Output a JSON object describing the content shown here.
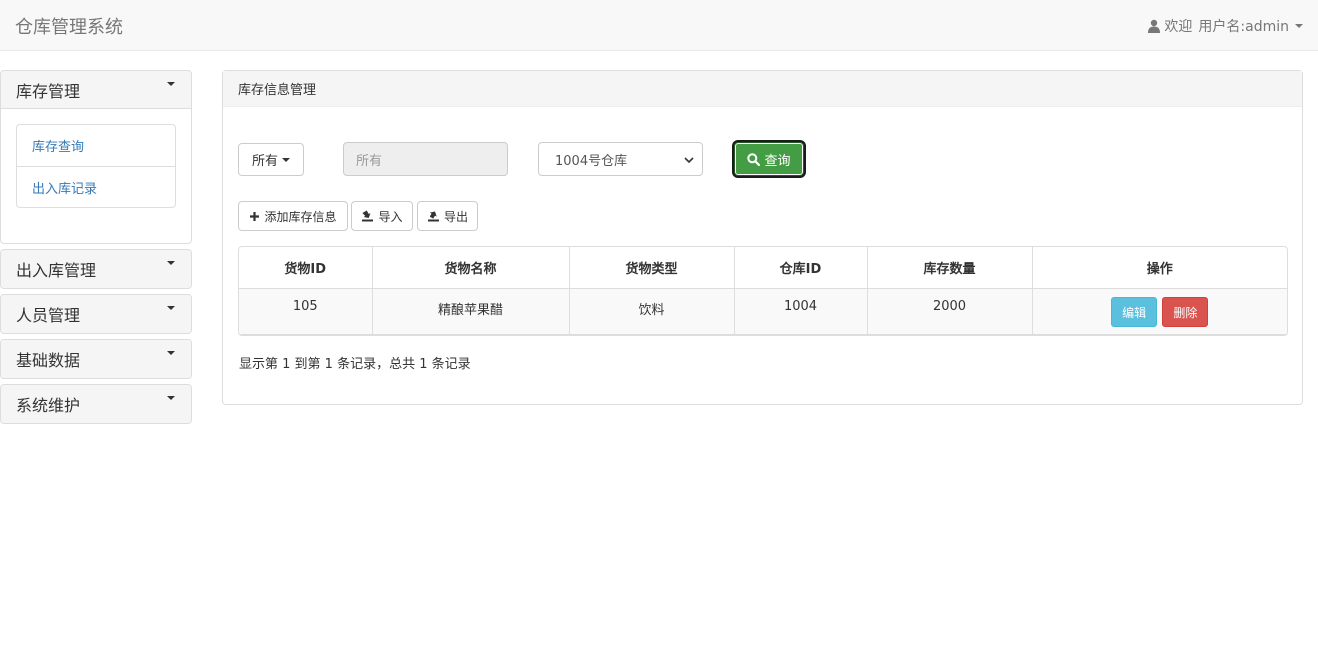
{
  "app": {
    "title": "仓库管理系统"
  },
  "user": {
    "welcome": "欢迎",
    "username_label": "用户名:admin"
  },
  "sidebar": {
    "sections": [
      {
        "label": "库存管理",
        "expanded": true,
        "items": [
          "库存查询",
          "出入库记录"
        ]
      },
      {
        "label": "出入库管理"
      },
      {
        "label": "人员管理"
      },
      {
        "label": "基础数据"
      },
      {
        "label": "系统维护"
      }
    ]
  },
  "main": {
    "panel_title": "库存信息管理",
    "filter": {
      "dropdown_label": "所有",
      "input_value": "所有",
      "warehouse_selected": "1004号仓库",
      "query_label": "查询"
    },
    "toolbar": {
      "add_label": "添加库存信息",
      "import_label": "导入",
      "export_label": "导出"
    },
    "table": {
      "columns": [
        "货物ID",
        "货物名称",
        "货物类型",
        "仓库ID",
        "库存数量",
        "操作"
      ],
      "rows": [
        {
          "id": "105",
          "name": "精酿苹果醋",
          "type": "饮料",
          "warehouse_id": "1004",
          "quantity": "2000",
          "edit_label": "编辑",
          "delete_label": "删除"
        }
      ]
    },
    "pagination_info": "显示第 1 到第 1 条记录，总共 1 条记录"
  },
  "colors": {
    "query_button": "#449d44",
    "edit_button": "#5bc0de",
    "delete_button": "#d9534f",
    "link": "#337ab7"
  }
}
